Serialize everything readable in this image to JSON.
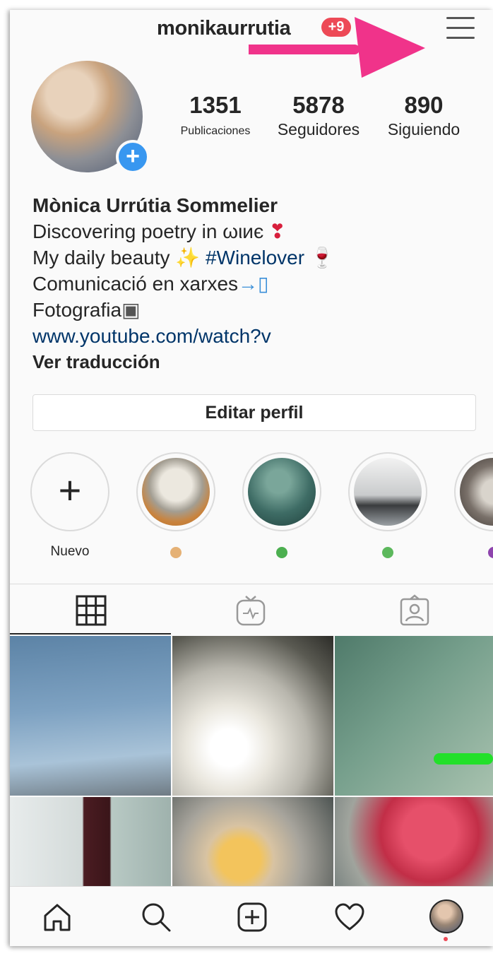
{
  "header": {
    "username": "monikaurrutia",
    "notification_badge": "+9"
  },
  "profile": {
    "stats": [
      {
        "value": "1351",
        "label": "Publicaciones"
      },
      {
        "value": "5878",
        "label": "Seguidores"
      },
      {
        "value": "890",
        "label": "Siguiendo"
      }
    ],
    "bio": {
      "name": "Mònica Urrútia Sommelier",
      "line1": "Discovering poetry in ωιиє",
      "line2_text": "My daily beauty ",
      "line2_tag": "#Winelover",
      "line3": "Comunicació en xarxes",
      "line4": "Fotografia",
      "link": "www.youtube.com/watch?v",
      "translate": "Ver traducción"
    },
    "edit_button": "Editar perfil"
  },
  "highlights": [
    {
      "label": "Nuevo",
      "type": "new"
    },
    {
      "label": "",
      "type": "story",
      "color": "#c9833d"
    },
    {
      "label": "",
      "type": "story",
      "color": "#2f5b55"
    },
    {
      "label": "",
      "type": "story",
      "color": "#8a8f94"
    },
    {
      "label": "",
      "type": "story",
      "color": "#6d6660"
    }
  ],
  "colors": {
    "badge_red": "#ed4956",
    "link_blue": "#003569",
    "accent_blue": "#3897f0",
    "annotation_pink": "#f0338a",
    "annotation_green": "#22e02a"
  }
}
